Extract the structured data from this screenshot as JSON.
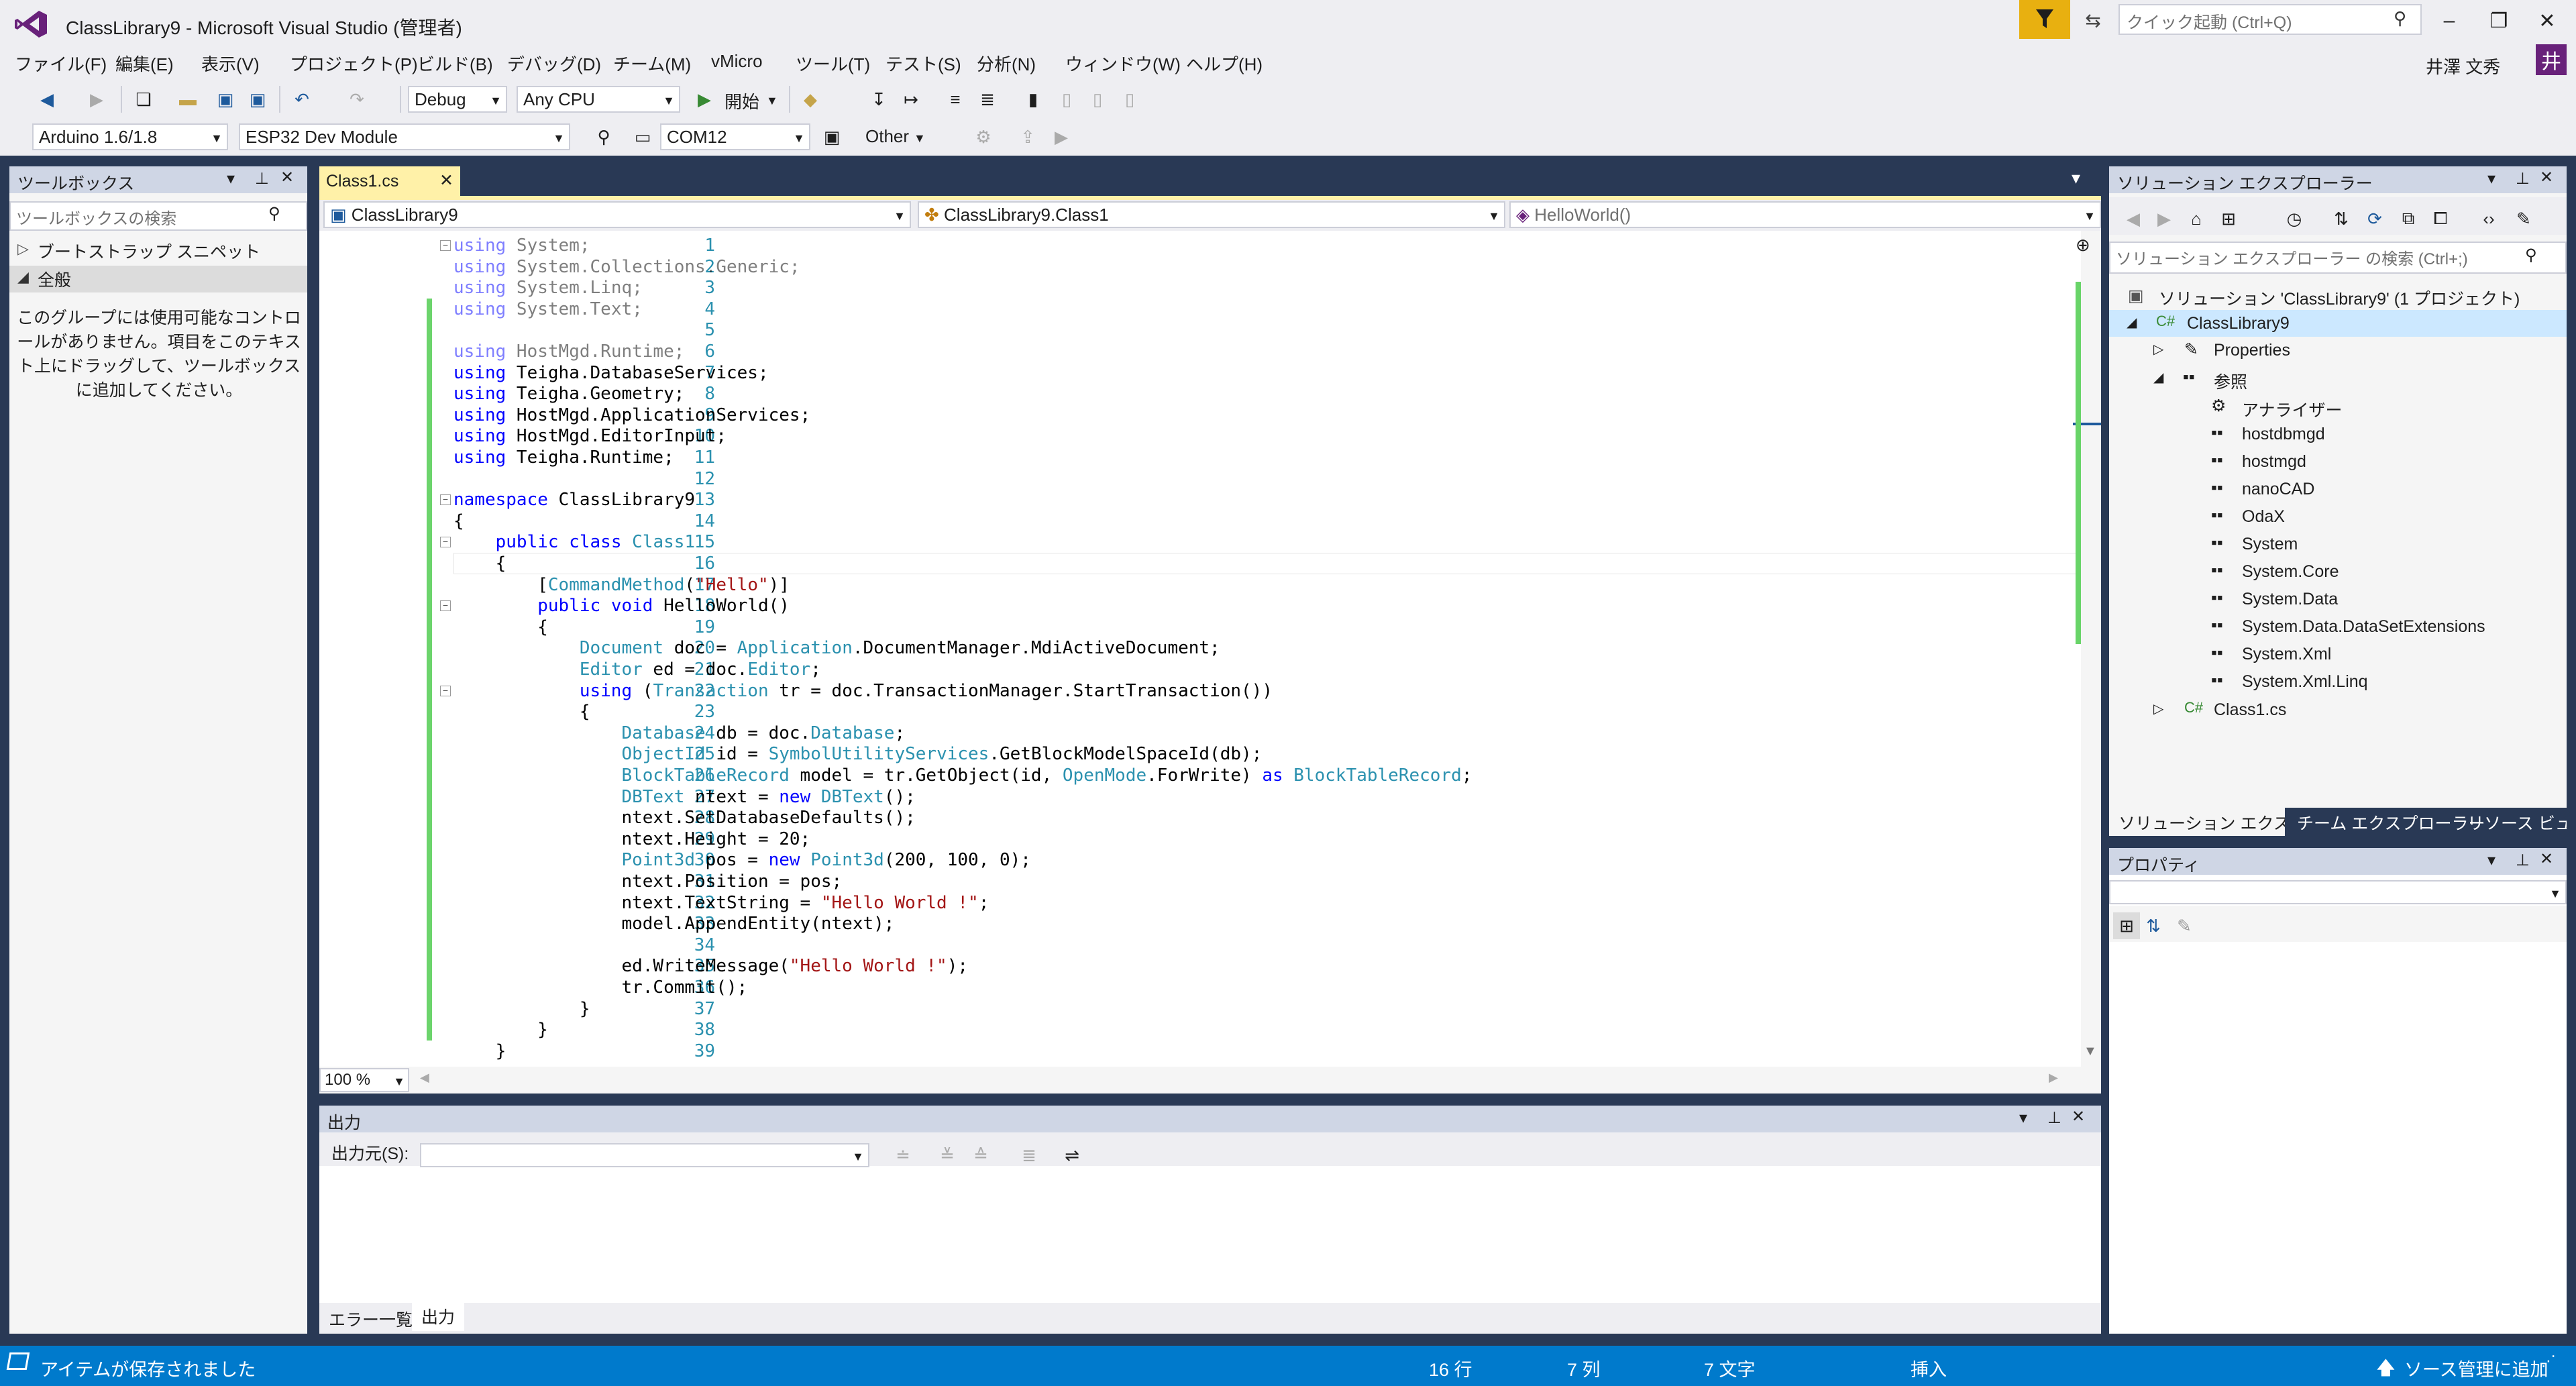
{
  "window": {
    "title": "ClassLibrary9 - Microsoft Visual Studio  (管理者)",
    "quick_launch_placeholder": "クイック起動 (Ctrl+Q)",
    "user": "井澤 文秀",
    "avatar": "井",
    "minimize": "–",
    "restore": "❐",
    "close": "✕"
  },
  "menu": [
    "ファイル(F)",
    "編集(E)",
    "表示(V)",
    "プロジェクト(P)",
    "ビルド(B)",
    "デバッグ(D)",
    "チーム(M)",
    "vMicro",
    "ツール(T)",
    "テスト(S)",
    "分析(N)",
    "ウィンドウ(W)",
    "ヘルプ(H)"
  ],
  "toolbar": {
    "config": "Debug",
    "platform": "Any CPU",
    "start": "開始",
    "board": "Arduino 1.6/1.8",
    "module": "ESP32 Dev Module",
    "port": "COM12",
    "other": "Other"
  },
  "toolbox": {
    "title": "ツールボックス",
    "search_placeholder": "ツールボックスの検索",
    "groups": [
      "ブートストラップ スニペット",
      "全般"
    ],
    "empty_message": "このグループには使用可能なコントロールがありません。項目をこのテキスト上にドラッグして、ツールボックスに追加してください。"
  },
  "editor": {
    "tab": "Class1.cs",
    "nav_project": "ClassLibrary9",
    "nav_class": "ClassLibrary9.Class1",
    "nav_member": "HelloWorld()",
    "zoom": "100 %",
    "lines": [
      "using System;",
      "using System.Collections.Generic;",
      "using System.Linq;",
      "using System.Text;",
      "",
      "using HostMgd.Runtime;",
      "using Teigha.DatabaseServices;",
      "using Teigha.Geometry;",
      "using HostMgd.ApplicationServices;",
      "using HostMgd.EditorInput;",
      "using Teigha.Runtime;",
      "",
      "namespace ClassLibrary9",
      "{",
      "    public class Class1",
      "    {",
      "        [CommandMethod(\"Hello\")]",
      "        public void HelloWorld()",
      "        {",
      "            Document doc = Application.DocumentManager.MdiActiveDocument;",
      "            Editor ed = doc.Editor;",
      "            using (Transaction tr = doc.TransactionManager.StartTransaction())",
      "            {",
      "                Database db = doc.Database;",
      "                ObjectId id = SymbolUtilityServices.GetBlockModelSpaceId(db);",
      "                BlockTableRecord model = tr.GetObject(id, OpenMode.ForWrite) as BlockTableRecord;",
      "                DBText ntext = new DBText();",
      "                ntext.SetDatabaseDefaults();",
      "                ntext.Height = 20;",
      "                Point3d pos = new Point3d(200, 100, 0);",
      "                ntext.Position = pos;",
      "                ntext.TextString = \"Hello World !\";",
      "                model.AppendEntity(ntext);",
      "",
      "                ed.WriteMessage(\"Hello World !\");",
      "                tr.Commit();",
      "            }",
      "        }",
      "    }"
    ]
  },
  "output": {
    "title": "出力",
    "source_label": "出力元(S):",
    "tabs": [
      "エラー一覧",
      "出力"
    ]
  },
  "solution_explorer": {
    "title": "ソリューション エクスプローラー",
    "search_placeholder": "ソリューション エクスプローラー の検索 (Ctrl+;)",
    "solution": "ソリューション 'ClassLibrary9' (1 プロジェクト)",
    "project": "ClassLibrary9",
    "properties": "Properties",
    "references": "参照",
    "reference_items": [
      "アナライザー",
      "hostdbmgd",
      "hostmgd",
      "nanoCAD",
      "OdaX",
      "System",
      "System.Core",
      "System.Data",
      "System.Data.DataSetExtensions",
      "System.Xml",
      "System.Xml.Linq"
    ],
    "file": "Class1.cs",
    "tabs": [
      "ソリューション エクスプ...",
      "チーム エクスプローラー",
      "リソース ビュー"
    ]
  },
  "properties": {
    "title": "プロパティ"
  },
  "status": {
    "message": "アイテムが保存されました",
    "line": "16 行",
    "col": "7 列",
    "char": "7 文字",
    "mode": "挿入",
    "source_control": "ソース管理に追加"
  },
  "colors": {
    "accent": "#007acc",
    "chrome": "#eeeef2",
    "keyword": "#0000ff",
    "type": "#2b91af",
    "string": "#a31515",
    "vs_purple": "#68217a"
  }
}
